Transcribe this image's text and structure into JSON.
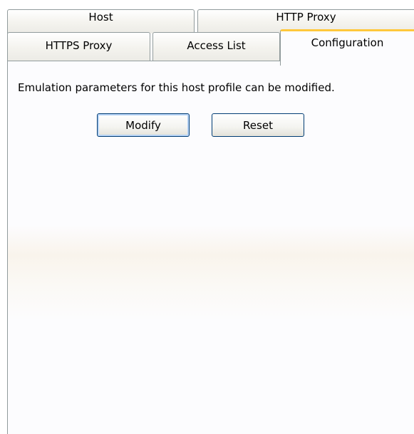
{
  "tabs": {
    "row1": [
      {
        "label": "Host"
      },
      {
        "label": "HTTP Proxy"
      }
    ],
    "row2": [
      {
        "label": "HTTPS Proxy"
      },
      {
        "label": "Access List"
      },
      {
        "label": "Configuration",
        "active": true
      }
    ]
  },
  "panel": {
    "description": "Emulation parameters for this host profile can be modified.",
    "buttons": {
      "modify": "Modify",
      "reset": "Reset"
    }
  },
  "colors": {
    "active_tab_highlight": "#ffc83c",
    "tab_border": "#919b9c",
    "button_border": "#003c74",
    "panel_background": "#fcfcfe"
  }
}
